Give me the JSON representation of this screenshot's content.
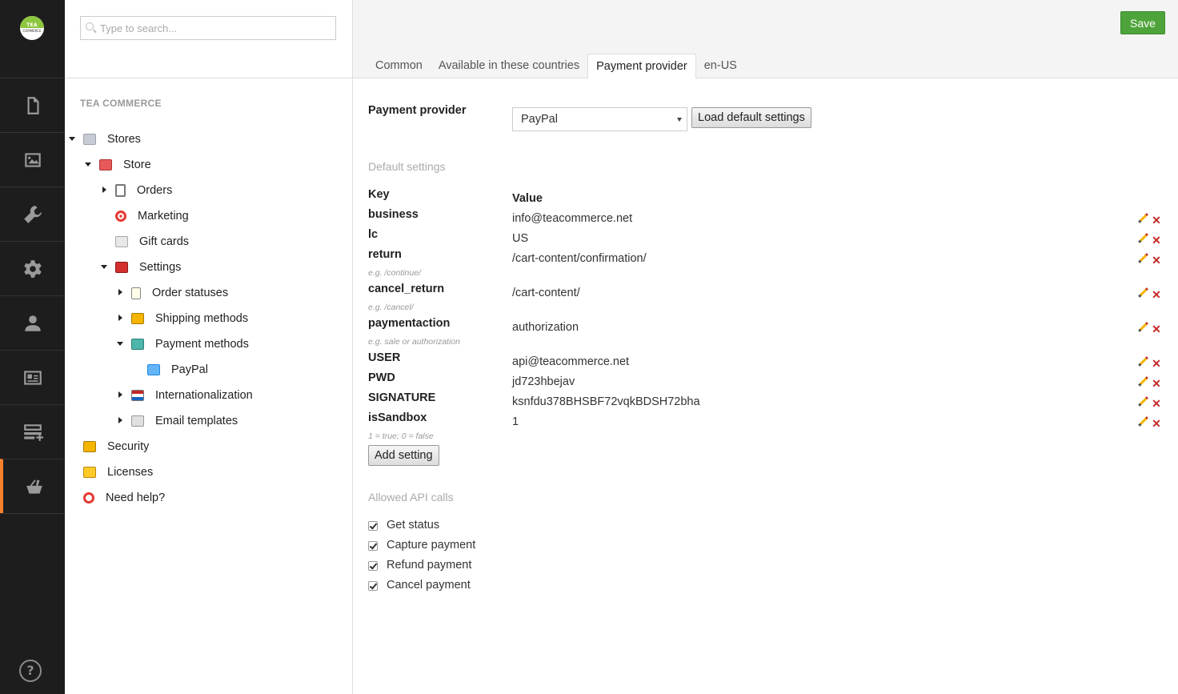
{
  "app": {
    "logo_text": "TEA",
    "logo_subtext": "COMMERCE",
    "rail_sections": [
      {
        "icon": "content-icon"
      },
      {
        "icon": "media-icon"
      },
      {
        "icon": "developer-icon"
      },
      {
        "icon": "settings-icon"
      },
      {
        "icon": "users-icon"
      },
      {
        "icon": "members-icon"
      },
      {
        "icon": "forms-icon"
      },
      {
        "icon": "tea-commerce-icon",
        "active": true
      }
    ],
    "help_label": "?"
  },
  "tree": {
    "search_placeholder": "Type to search...",
    "heading": "TEA COMMERCE",
    "nodes": {
      "stores": "Stores",
      "store": "Store",
      "orders": "Orders",
      "marketing": "Marketing",
      "gift_cards": "Gift cards",
      "settings": "Settings",
      "order_statuses": "Order statuses",
      "shipping_methods": "Shipping methods",
      "payment_methods": "Payment methods",
      "paypal": "PayPal",
      "internationalization": "Internationalization",
      "email_templates": "Email templates",
      "security": "Security",
      "licenses": "Licenses",
      "need_help": "Need help?"
    }
  },
  "header": {
    "save_label": "Save",
    "tabs": [
      "Common",
      "Available in these countries",
      "Payment provider",
      "en-US"
    ],
    "active_tab": "Payment provider"
  },
  "form": {
    "provider_label": "Payment provider",
    "provider_value": "PayPal",
    "load_defaults_label": "Load default settings",
    "default_settings_heading": "Default settings",
    "key_header": "Key",
    "value_header": "Value",
    "settings": [
      {
        "key": "business",
        "value": "info@teacommerce.net",
        "hint": ""
      },
      {
        "key": "lc",
        "value": "US",
        "hint": ""
      },
      {
        "key": "return",
        "value": "/cart-content/confirmation/",
        "hint": "e.g. /continue/"
      },
      {
        "key": "cancel_return",
        "value": "/cart-content/",
        "hint": "e.g. /cancel/"
      },
      {
        "key": "paymentaction",
        "value": "authorization",
        "hint": "e.g. sale or authorization"
      },
      {
        "key": "USER",
        "value": "api@teacommerce.net",
        "hint": ""
      },
      {
        "key": "PWD",
        "value": "jd723hbejav",
        "hint": ""
      },
      {
        "key": "SIGNATURE",
        "value": "ksnfdu378BHSBF72vqkBDSH72bha",
        "hint": ""
      },
      {
        "key": "isSandbox",
        "value": "1",
        "hint": "1 = true; 0 = false"
      }
    ],
    "add_setting_label": "Add setting",
    "allowed_api_heading": "Allowed API calls",
    "api_calls": [
      {
        "label": "Get status",
        "checked": true
      },
      {
        "label": "Capture payment",
        "checked": true
      },
      {
        "label": "Refund payment",
        "checked": true
      },
      {
        "label": "Cancel payment",
        "checked": true
      }
    ]
  }
}
